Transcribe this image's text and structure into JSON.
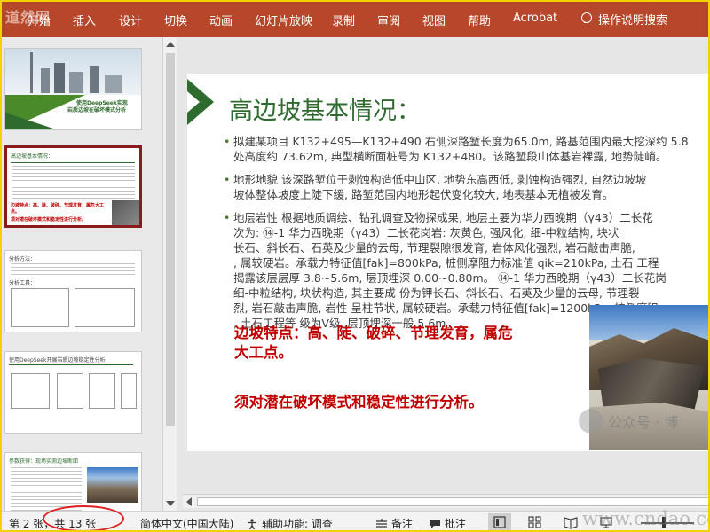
{
  "ribbon": {
    "logo_watermark": "道然网",
    "tabs": [
      "开始",
      "插入",
      "设计",
      "切换",
      "动画",
      "幻灯片放映",
      "录制",
      "审阅",
      "视图",
      "帮助",
      "Acrobat"
    ],
    "tell_me": "操作说明搜索"
  },
  "thumbnails": [
    {
      "num": "",
      "lines": [
        "使用DeepSeek实现",
        "岩质边坡在破坏模式分析"
      ]
    },
    {
      "num": "",
      "lines": [
        "高边坡基本情况：",
        "边坡特点：高、陡、破碎、节理发育，属危大工点。",
        "须对潜在破坏模式和稳定性进行分析。"
      ]
    },
    {
      "num": "",
      "lines": [
        "分析方法：",
        "分析工具："
      ]
    },
    {
      "num": "",
      "lines": [
        "使用DeepSeek开展岩质边坡稳定性分析"
      ]
    },
    {
      "num": "",
      "lines": [
        "参数获得：现场实测边坡断面"
      ]
    }
  ],
  "slide": {
    "title": "高边坡基本情况：",
    "bullets": [
      "拟建某项目 K132+495—K132+490 右侧深路堑长度为65.0m, 路基范围内最大挖深约 5.8\n处高度约 73.62m, 典型横断面桩号为 K132+480。该路堑段山体基岩裸露, 地势陡峭。",
      "地形地貌 该深路堑位于剥蚀构造低中山区, 地势东高西低, 剥蚀构造强烈, 自然边坡坡\n坡体整体坡度上陡下缓, 路堑范围内地形起伏变化较大, 地表基本无植被发育。",
      "地层岩性 根据地质调绘、钻孔调查及物探成果, 地层主要为华力西晚期（γ43）二长花\n次为: ⑭-1 华力西晚期（γ43）二长花岗岩: 灰黄色, 强风化, 细-中粒结构, 块状\n长石、斜长石、石英及少量的云母, 节理裂隙很发育, 岩体风化强烈, 岩石敲击声脆, \n, 属较硬岩。承载力特征值[fak]=800kPa, 桩侧摩阻力标准值 qik=210kPa, 土石 工程\n揭露该层层厚 3.8~5.6m, 层顶埋深 0.00~0.80m。 ⑭-1 华力西晚期（γ43）二长花岗\n细-中粒结构, 块状构造, 其主要成 份为钾长石、斜长石、石英及少量的云母, 节理裂\n烈, 岩石敲击声脆, 岩性 呈柱节状, 属较硬岩。承载力特征值[fak]=1200kPa, 桩侧摩阻\n, 土石工程等 级为Ⅴ级, 层顶埋深一般 5.6m。"
    ],
    "highlight1": "边坡特点：高、陡、破碎、节理发育，属危\n大工点。",
    "highlight2": "须对潜在破坏模式和稳定性进行分析。",
    "photo_watermark": "公众号 · 博"
  },
  "status": {
    "slide_count": "第 2 张，共 13 张",
    "language": "简体中文(中国大陆)",
    "accessibility": "辅助功能: 调查",
    "notes": "备注",
    "comments": "批注",
    "site_watermark": "www.cndao.com"
  },
  "colors": {
    "ribbon": "#b7472a",
    "title_green": "#2f6b2f",
    "highlight_red": "#c00000"
  }
}
